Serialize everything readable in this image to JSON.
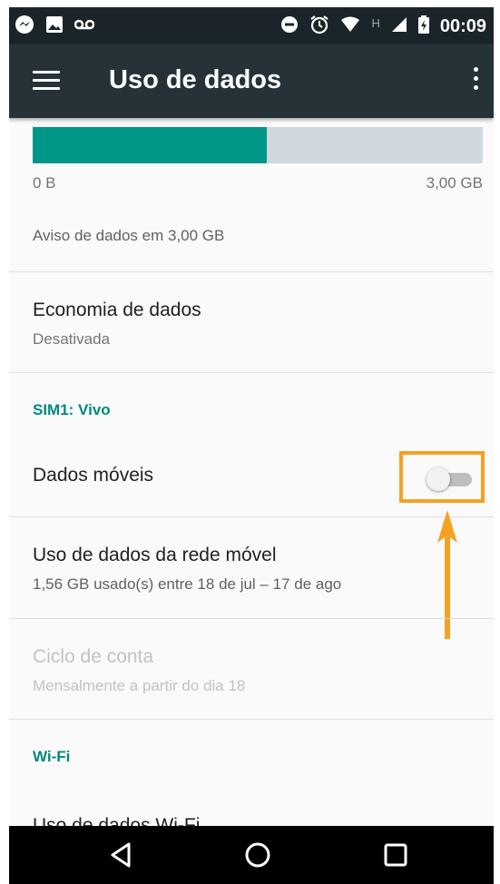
{
  "status_bar": {
    "time": "00:09",
    "network_letter": "H",
    "left_icons": [
      "messenger-icon",
      "image-icon",
      "voicemail-icon"
    ],
    "right_icons": [
      "do-not-disturb-icon",
      "alarm-icon",
      "wifi-icon",
      "signal-icon",
      "battery-icon"
    ]
  },
  "app_bar": {
    "title": "Uso de dados",
    "background": "#263238"
  },
  "usage_bar": {
    "used_fraction": 0.52,
    "min_label": "0 B",
    "max_label": "3,00 GB",
    "fill_color": "#009688"
  },
  "warning": "Aviso de dados em 3,00 GB",
  "data_saver": {
    "title": "Economia de dados",
    "status": "Desativada"
  },
  "sim_section": {
    "header": "SIM1: Vivo",
    "mobile_data": {
      "label": "Dados móveis",
      "enabled": false
    },
    "mobile_usage": {
      "title": "Uso de dados da rede móvel",
      "subtitle": "1,56 GB usado(s) entre 18 de jul – 17 de ago"
    },
    "billing_cycle": {
      "title": "Ciclo de conta",
      "subtitle": "Mensalmente a partir do dia 18"
    }
  },
  "wifi_section": {
    "header": "Wi-Fi",
    "wifi_usage_title": "Uso de dados Wi-Fi"
  },
  "accent_color": "#00897b",
  "highlight_color": "#f5a122"
}
